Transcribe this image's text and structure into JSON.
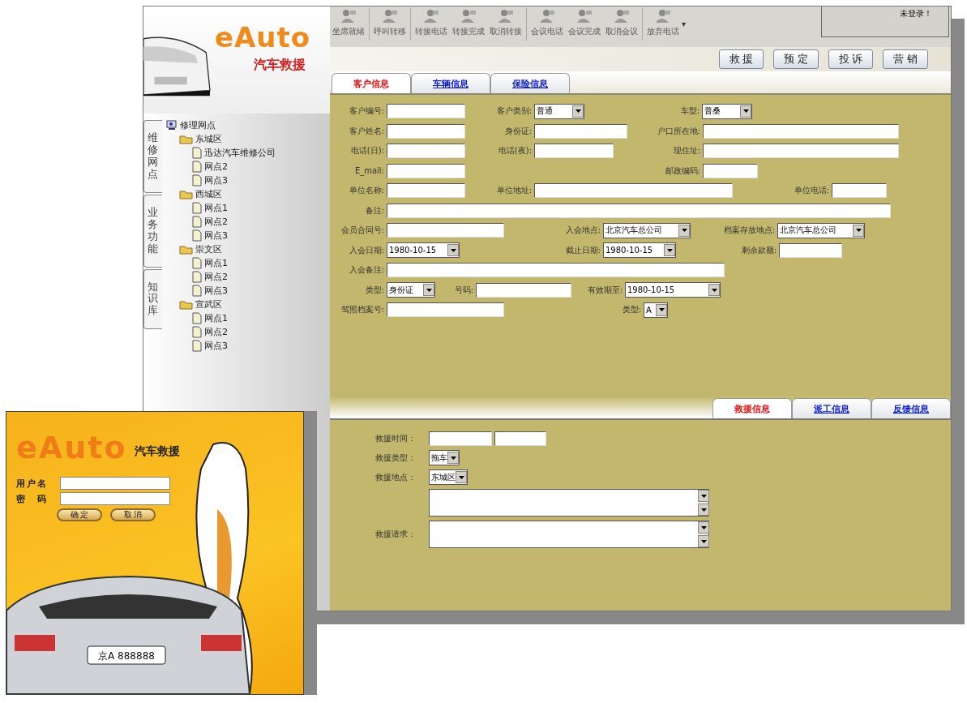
{
  "main_window": {
    "logo": {
      "brand": "eAuto",
      "tagline": "汽车救援"
    },
    "toolbar": [
      {
        "label": "坐席就绪"
      },
      {
        "label": "呼叫转移"
      },
      {
        "label": "转接电话"
      },
      {
        "label": "转接完成"
      },
      {
        "label": "取消转接"
      },
      {
        "label": "会议电话"
      },
      {
        "label": "会议完成"
      },
      {
        "label": "取消会议"
      },
      {
        "label": "放弃电话"
      }
    ],
    "toolbar_menu": "▾",
    "status": "未登录！",
    "action_buttons": [
      "救 援",
      "预 定",
      "投 诉",
      "营 销"
    ],
    "side_tabs": [
      "维修网点",
      "业务功能",
      "知识库"
    ],
    "tree": {
      "label": "修理网点",
      "children": [
        {
          "label": "东城区",
          "children": [
            {
              "label": "迅达汽车维修公司"
            },
            {
              "label": "网点2"
            },
            {
              "label": "网点3"
            }
          ]
        },
        {
          "label": "西城区",
          "children": [
            {
              "label": "网点1"
            },
            {
              "label": "网点2"
            },
            {
              "label": "网点3"
            }
          ]
        },
        {
          "label": "崇文区",
          "children": [
            {
              "label": "网点1"
            },
            {
              "label": "网点2"
            },
            {
              "label": "网点3"
            }
          ]
        },
        {
          "label": "宣武区",
          "children": [
            {
              "label": "网点1"
            },
            {
              "label": "网点2"
            },
            {
              "label": "网点3"
            }
          ]
        }
      ]
    },
    "tabs": [
      {
        "label": "客户信息",
        "selected": true
      },
      {
        "label": "车辆信息",
        "selected": false
      },
      {
        "label": "保险信息",
        "selected": false
      }
    ],
    "form_rows": [
      [
        {
          "label": "客户编号:",
          "kind": "text"
        },
        {
          "label": "客户类别:",
          "kind": "select",
          "value": "普通"
        },
        {
          "label": "车型:",
          "kind": "select",
          "value": "普桑"
        }
      ],
      [
        {
          "label": "客户姓名:",
          "kind": "text"
        },
        {
          "label": "身份证:",
          "kind": "text"
        },
        {
          "label": "户口所在地:",
          "kind": "text"
        }
      ],
      [
        {
          "label": "电话(日):",
          "kind": "text"
        },
        {
          "label": "电话(夜):",
          "kind": "text"
        },
        {
          "label": "现住址:",
          "kind": "text"
        }
      ],
      [
        {
          "label": "E_mail:",
          "kind": "text"
        },
        {
          "label": "邮政编码:",
          "kind": "text"
        }
      ],
      [
        {
          "label": "单位名称:",
          "kind": "text"
        },
        {
          "label": "单位地址:",
          "kind": "text"
        },
        {
          "label": "单位电话:",
          "kind": "text"
        }
      ],
      [
        {
          "label": "备注:",
          "kind": "text"
        }
      ],
      [
        {
          "label": "会员合同号:",
          "kind": "text"
        },
        {
          "label": "入会地点:",
          "kind": "select",
          "value": "北京汽车总公司"
        },
        {
          "label": "档案存放地点:",
          "kind": "select",
          "value": "北京汽车总公司"
        }
      ],
      [
        {
          "label": "入会日期:",
          "kind": "select",
          "value": "1980-10-15"
        },
        {
          "label": "截止日期:",
          "kind": "select",
          "value": "1980-10-15"
        },
        {
          "label": "剩余款额:",
          "kind": "text"
        }
      ],
      [
        {
          "label": "入会备注:",
          "kind": "text"
        }
      ],
      [
        {
          "label": "类型:",
          "kind": "select",
          "value": "身份证"
        },
        {
          "label": "号码:",
          "kind": "text"
        },
        {
          "label": "有效期至:",
          "kind": "select",
          "value": "1980-10-15"
        }
      ],
      [
        {
          "label": "驾照档案号:",
          "kind": "text"
        },
        {
          "label": "类型:",
          "kind": "select",
          "value": "A"
        }
      ]
    ],
    "lower_tabs": [
      {
        "label": "救援信息",
        "selected": true
      },
      {
        "label": "派工信息",
        "selected": false
      },
      {
        "label": "反馈信息",
        "selected": false
      }
    ],
    "rescue_form": [
      {
        "label": "救援时间：",
        "kind": "pair"
      },
      {
        "label": "救援类型：",
        "kind": "select",
        "value": "拖车"
      },
      {
        "label": "救援地点：",
        "kind": "select",
        "value": "东城区"
      },
      {
        "kind": "textarea"
      },
      {
        "label": "救援请求：",
        "kind": "textarea"
      }
    ]
  },
  "login_window": {
    "logo": {
      "brand": "eAuto",
      "tagline": "汽车救援"
    },
    "fields": [
      {
        "label": "用户名"
      },
      {
        "label": "密　码"
      }
    ],
    "buttons": [
      "确 定",
      "取 消"
    ],
    "plate": "京A 888888"
  }
}
